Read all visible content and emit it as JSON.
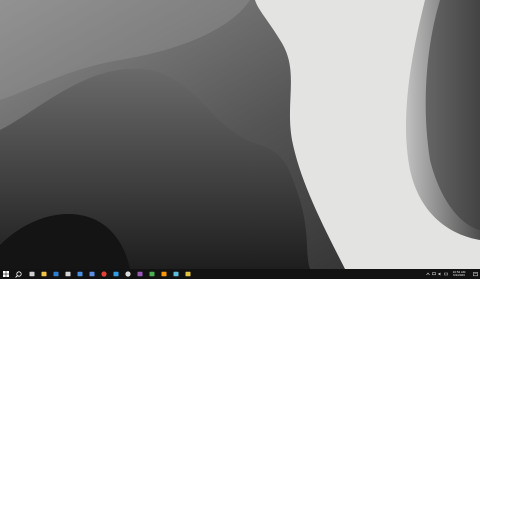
{
  "wallpaper": {
    "description_icon": "abstract-gray-waves",
    "colors": {
      "dark": "#1c1c1c",
      "mid": "#5a5a5a",
      "light": "#e4e5e3"
    }
  },
  "taskbar": {
    "background": "#121212",
    "start_icon": "windows-start-icon",
    "search_icon": "search-icon",
    "pinned": [
      {
        "name": "task-view",
        "color": "#cfcfcf"
      },
      {
        "name": "file-explorer",
        "color": "#f4c542"
      },
      {
        "name": "mail",
        "color": "#2d7fd4"
      },
      {
        "name": "store",
        "color": "#d6d6d6"
      },
      {
        "name": "notes",
        "color": "#4a90e2"
      },
      {
        "name": "app-blue",
        "color": "#5c8ee6"
      },
      {
        "name": "chrome",
        "color": "#e44134"
      },
      {
        "name": "vscode",
        "color": "#2f9ee6"
      },
      {
        "name": "settings",
        "color": "#dcdcdc"
      },
      {
        "name": "app-purple",
        "color": "#9b59b6"
      },
      {
        "name": "app-green",
        "color": "#4caf50"
      },
      {
        "name": "app-orange",
        "color": "#ff9800"
      },
      {
        "name": "app-cyan",
        "color": "#5bc0de"
      },
      {
        "name": "app-yellow",
        "color": "#e0c341"
      }
    ],
    "tray": {
      "icons": [
        "chevron-up-icon",
        "network-icon",
        "volume-icon",
        "keyboard-icon"
      ],
      "time": "10:54 AM",
      "date": "6/1/2023"
    }
  }
}
